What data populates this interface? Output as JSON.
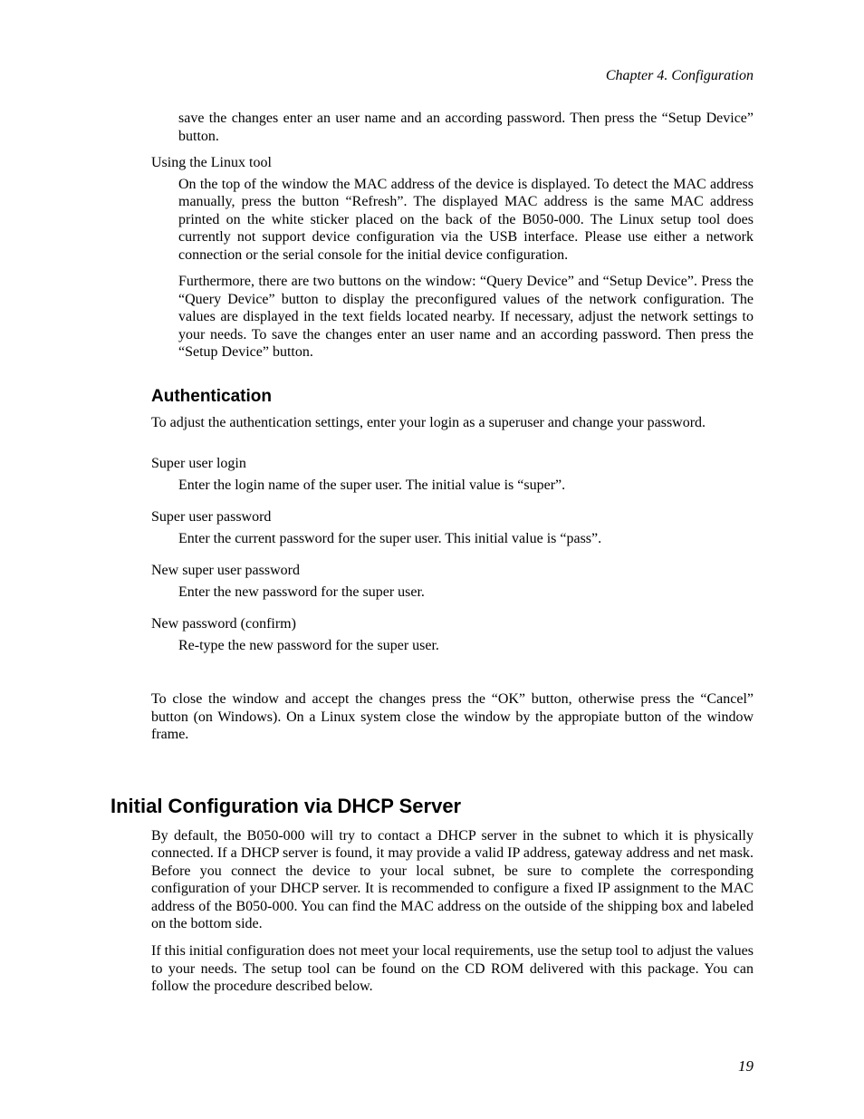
{
  "header": {
    "chapter": "Chapter 4. Configuration"
  },
  "intro": {
    "cont1": "save the changes enter an user name and an according password. Then press the “Setup Device” button.",
    "linux_term": "Using the Linux tool",
    "linux_p1": "On the top of the window the MAC address of the device is displayed. To detect the MAC address manually, press the button “Refresh”. The displayed MAC address is the same MAC address printed on the white sticker placed on the back of the B050-000. The Linux setup tool does currently not support device configuration via the USB interface. Please use either a network connection or the serial console for the initial device configuration.",
    "linux_p2": "Furthermore, there are two buttons on the window: “Query Device” and “Setup Device”. Press the “Query Device” button to display the preconfigured values of the network configuration. The values are displayed in the text fields located nearby. If necessary, adjust the network settings to your needs. To save the changes enter an user name and an according password. Then press the “Setup Device” button."
  },
  "auth": {
    "heading": "Authentication",
    "intro": "To adjust the authentication settings, enter your login as a superuser and change your password.",
    "items": [
      {
        "term": "Super user login",
        "desc": "Enter the login name of the super user. The initial value is “super”."
      },
      {
        "term": "Super user password",
        "desc": "Enter the current password for the super user. This initial value is “pass”."
      },
      {
        "term": "New super user password",
        "desc": "Enter the new password for the super user."
      },
      {
        "term": "New password (confirm)",
        "desc": "Re-type the new password for the super user."
      }
    ],
    "close": "To close the window and accept the changes press the “OK” button, otherwise press the “Cancel” button (on Windows). On a Linux system close the window by the appropiate button of the window frame."
  },
  "dhcp": {
    "heading": "Initial Configuration via DHCP Server",
    "p1": "By default, the B050-000 will try to contact a DHCP server in the subnet to which it is physically connected. If a DHCP server is found, it may provide a valid IP address, gateway address and net mask. Before you connect the device to your local subnet, be sure to complete the corresponding configuration of your DHCP server. It is recommended to configure a fixed IP assignment to the MAC address of the B050-000. You can find the MAC address on the outside of the shipping box and labeled on the bottom side.",
    "p2": "If this initial configuration does not meet your local requirements, use the setup tool to adjust the values to your needs. The setup tool can be found on the CD ROM delivered with this package. You can follow the procedure described below."
  },
  "page_number": "19"
}
